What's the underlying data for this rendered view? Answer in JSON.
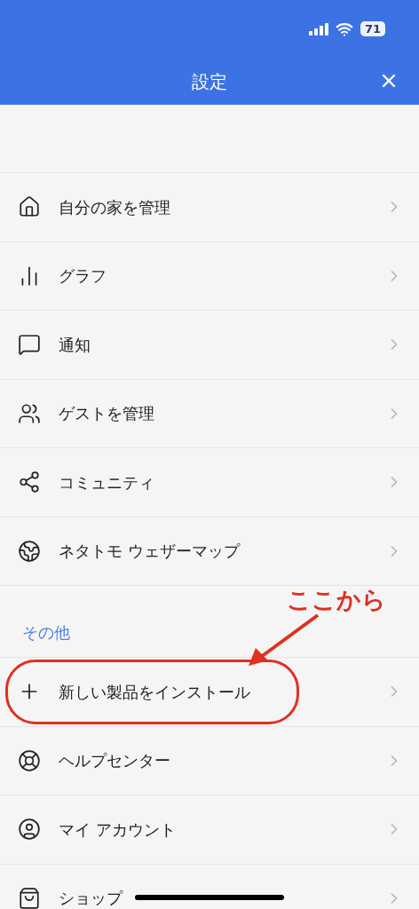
{
  "status_bar": {
    "battery": "71"
  },
  "header": {
    "title": "設定"
  },
  "sections": [
    {
      "items": [
        {
          "label": "自分の家を管理",
          "kind": "home"
        },
        {
          "label": "グラフ",
          "kind": "chart"
        },
        {
          "label": "通知",
          "kind": "notification"
        },
        {
          "label": "ゲストを管理",
          "kind": "guests"
        },
        {
          "label": "コミュニティ",
          "kind": "community"
        },
        {
          "label": "ネタトモ ウェザーマップ",
          "kind": "globe"
        }
      ]
    },
    {
      "title": "その他",
      "items": [
        {
          "label": "新しい製品をインストール",
          "kind": "plus",
          "highlighted": true
        },
        {
          "label": "ヘルプセンター",
          "kind": "help"
        },
        {
          "label": "マイ アカウント",
          "kind": "account"
        },
        {
          "label": "ショップ",
          "kind": "shop"
        }
      ]
    }
  ],
  "annotation": {
    "text": "ここから"
  }
}
